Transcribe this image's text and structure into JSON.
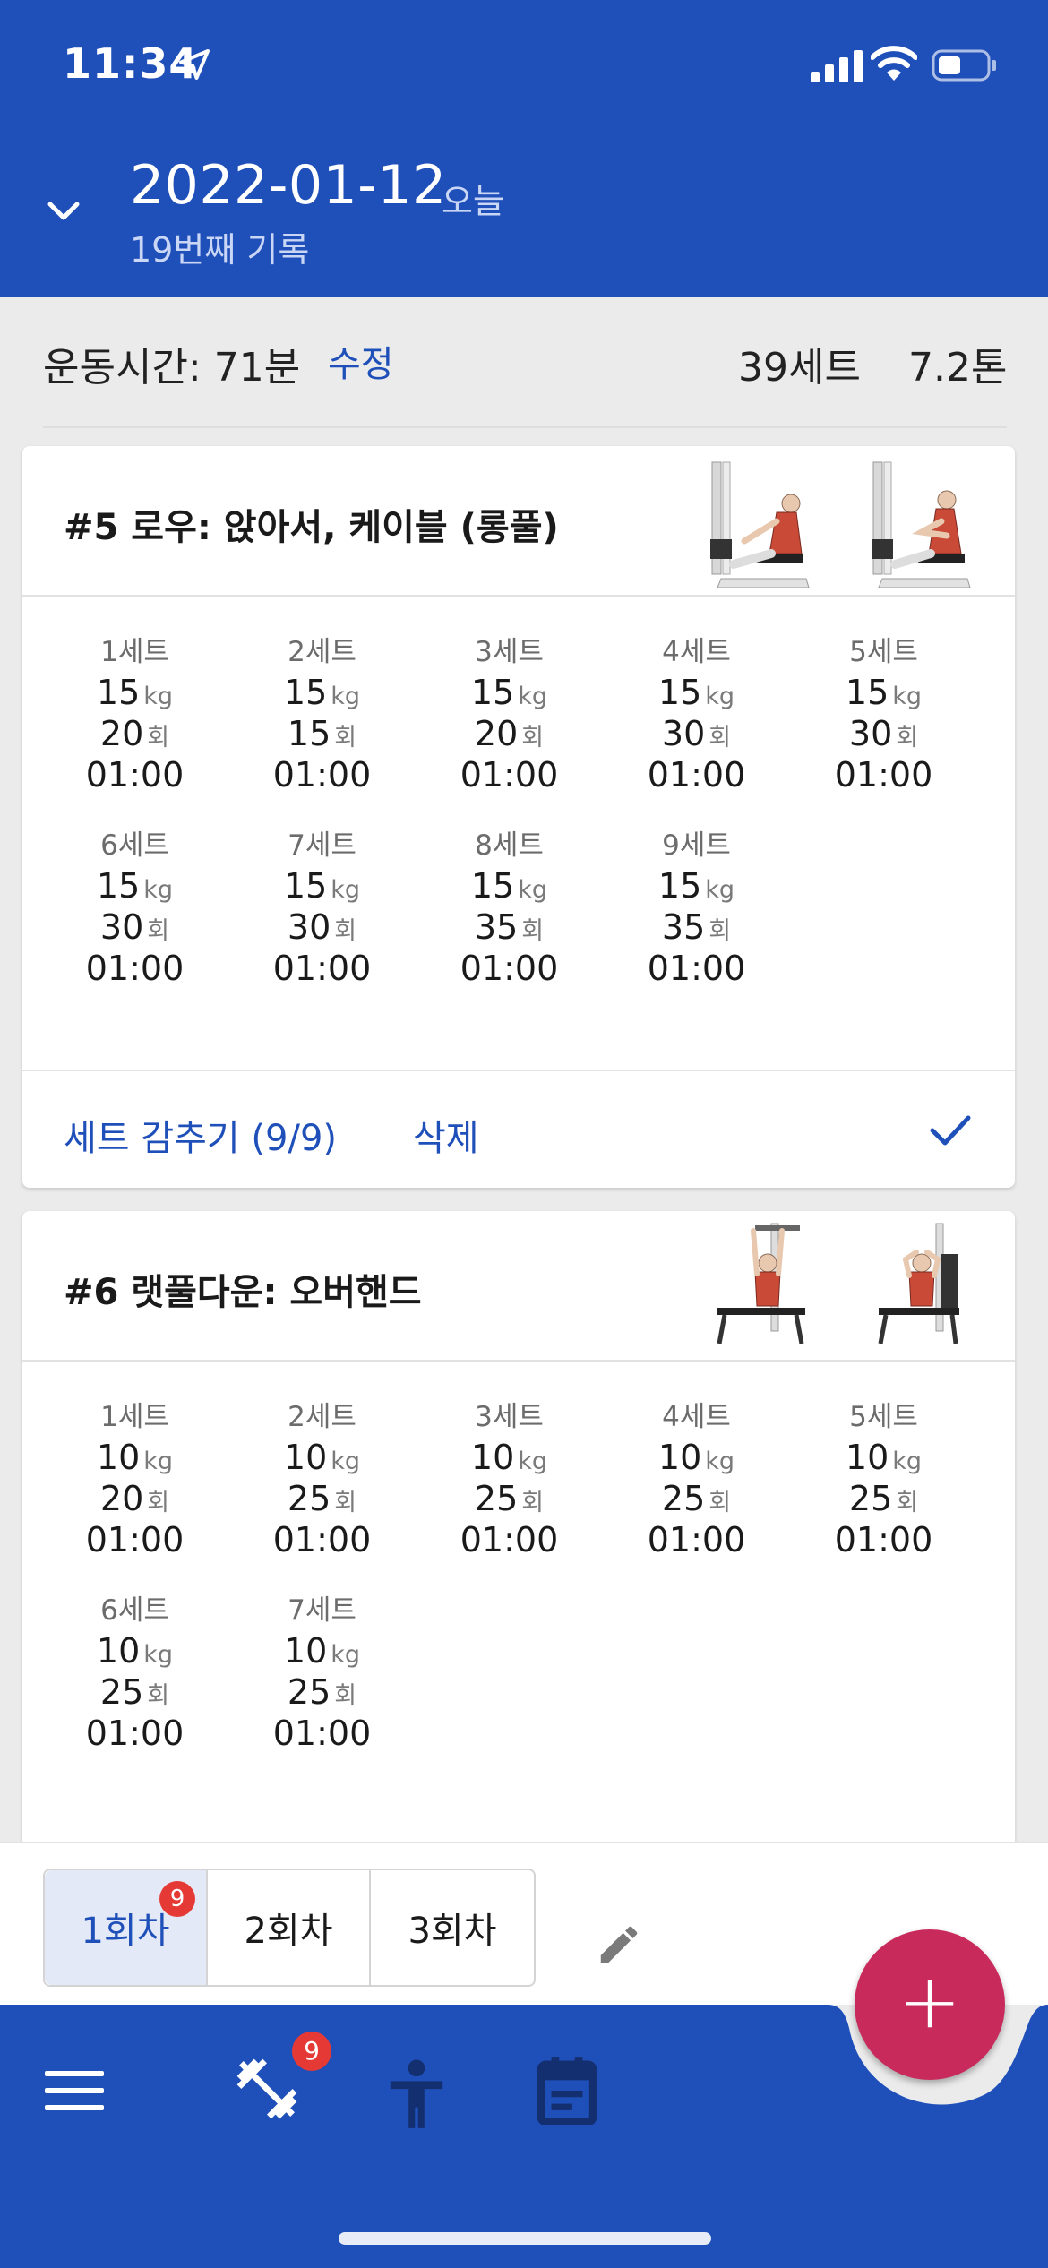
{
  "status_bar": {
    "time": "11:34"
  },
  "header": {
    "date": "2022-01-12",
    "today_label": "오늘",
    "record_count": "19번째 기록"
  },
  "summary": {
    "workout_time": "운동시간: 71분",
    "edit_label": "수정",
    "total_sets": "39세트",
    "total_volume": "7.2톤"
  },
  "exercises": [
    {
      "title": "#5 로우: 앉아서, 케이블 (롱풀)",
      "sets": [
        {
          "label": "1세트",
          "weight": "15",
          "weight_unit": "kg",
          "reps": "20",
          "reps_unit": "회",
          "time": "01:00"
        },
        {
          "label": "2세트",
          "weight": "15",
          "weight_unit": "kg",
          "reps": "15",
          "reps_unit": "회",
          "time": "01:00"
        },
        {
          "label": "3세트",
          "weight": "15",
          "weight_unit": "kg",
          "reps": "20",
          "reps_unit": "회",
          "time": "01:00"
        },
        {
          "label": "4세트",
          "weight": "15",
          "weight_unit": "kg",
          "reps": "30",
          "reps_unit": "회",
          "time": "01:00"
        },
        {
          "label": "5세트",
          "weight": "15",
          "weight_unit": "kg",
          "reps": "30",
          "reps_unit": "회",
          "time": "01:00"
        },
        {
          "label": "6세트",
          "weight": "15",
          "weight_unit": "kg",
          "reps": "30",
          "reps_unit": "회",
          "time": "01:00"
        },
        {
          "label": "7세트",
          "weight": "15",
          "weight_unit": "kg",
          "reps": "30",
          "reps_unit": "회",
          "time": "01:00"
        },
        {
          "label": "8세트",
          "weight": "15",
          "weight_unit": "kg",
          "reps": "35",
          "reps_unit": "회",
          "time": "01:00"
        },
        {
          "label": "9세트",
          "weight": "15",
          "weight_unit": "kg",
          "reps": "35",
          "reps_unit": "회",
          "time": "01:00"
        }
      ],
      "hide_sets_label": "세트 감추기 (9/9)",
      "delete_label": "삭제"
    },
    {
      "title": "#6 랫풀다운: 오버핸드",
      "sets": [
        {
          "label": "1세트",
          "weight": "10",
          "weight_unit": "kg",
          "reps": "20",
          "reps_unit": "회",
          "time": "01:00"
        },
        {
          "label": "2세트",
          "weight": "10",
          "weight_unit": "kg",
          "reps": "25",
          "reps_unit": "회",
          "time": "01:00"
        },
        {
          "label": "3세트",
          "weight": "10",
          "weight_unit": "kg",
          "reps": "25",
          "reps_unit": "회",
          "time": "01:00"
        },
        {
          "label": "4세트",
          "weight": "10",
          "weight_unit": "kg",
          "reps": "25",
          "reps_unit": "회",
          "time": "01:00"
        },
        {
          "label": "5세트",
          "weight": "10",
          "weight_unit": "kg",
          "reps": "25",
          "reps_unit": "회",
          "time": "01:00"
        },
        {
          "label": "6세트",
          "weight": "10",
          "weight_unit": "kg",
          "reps": "25",
          "reps_unit": "회",
          "time": "01:00"
        },
        {
          "label": "7세트",
          "weight": "10",
          "weight_unit": "kg",
          "reps": "25",
          "reps_unit": "회",
          "time": "01:00"
        }
      ]
    }
  ],
  "session_tabs": [
    {
      "label": "1회차",
      "badge": "9",
      "active": true
    },
    {
      "label": "2회차"
    },
    {
      "label": "3회차"
    }
  ],
  "bottom_nav": {
    "items": [
      "menu-icon",
      "dumbbell-icon",
      "person-icon",
      "calendar-icon"
    ],
    "workout_badge": "9"
  },
  "fab_label": "+",
  "colors": {
    "primary": "#1f4fb9",
    "fab": "#c92a5c",
    "badge": "#e53935",
    "background": "#ebebeb"
  }
}
